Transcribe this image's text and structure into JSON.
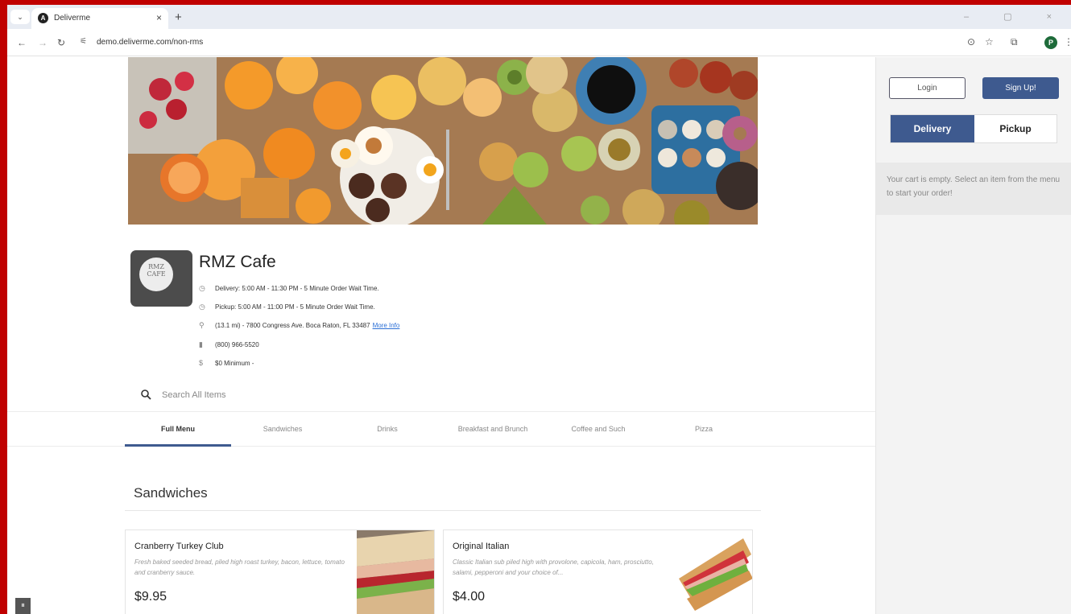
{
  "browser": {
    "tab_title": "Deliverme",
    "tab_close": "×",
    "new_tab": "+",
    "tab_menu": "⌄",
    "favicon_letter": "A",
    "url": "demo.deliverme.com/non-rms",
    "window_controls": "–  ▢  ×",
    "profile_initial": "P",
    "icons": [
      "back-icon",
      "forward-icon",
      "reload-icon",
      "site-settings-icon",
      "location-icon",
      "star-icon",
      "extensions-icon",
      "profile-icon",
      "menu-icon"
    ]
  },
  "auth": {
    "login_label": "Login",
    "signup_label": "Sign Up!"
  },
  "order_mode": {
    "delivery_label": "Delivery",
    "pickup_label": "Pickup",
    "selected": "Delivery"
  },
  "cart": {
    "empty_message": "Your cart is empty. Select an item from the menu to start your order!"
  },
  "restaurant": {
    "name": "RMZ Cafe",
    "logo_text_1": "RMZ",
    "logo_text_2": "CAFE",
    "delivery_hours": "Delivery: 5:00 AM - 11:30 PM - 5 Minute Order Wait Time.",
    "pickup_hours": "Pickup: 5:00 AM - 11:00 PM - 5 Minute Order Wait Time.",
    "address": "(13.1 mi) - 7800 Congress Ave. Boca Raton, FL 33487",
    "more_info_label": "More Info",
    "phone": "(800) 966-5520",
    "minimum": "$0 Minimum -"
  },
  "search": {
    "placeholder": "Search All Items"
  },
  "categories": [
    {
      "label": "Full Menu",
      "active": true
    },
    {
      "label": "Sandwiches",
      "active": false
    },
    {
      "label": "Drinks",
      "active": false
    },
    {
      "label": "Breakfast and Brunch",
      "active": false
    },
    {
      "label": "Coffee and Such",
      "active": false
    },
    {
      "label": "Pizza",
      "active": false
    }
  ],
  "menu": {
    "section_title": "Sandwiches",
    "items": [
      {
        "name": "Cranberry Turkey Club",
        "description": "Fresh baked seeded bread, piled high roast turkey, bacon, lettuce, tomato and cranberry sauce.",
        "price": "$9.95"
      },
      {
        "name": "Original Italian",
        "description": "Classic Italian sub piled high with provolone, capicola, ham, prosciutto, salami, pepperoni and your choice of...",
        "price": "$4.00"
      }
    ]
  },
  "colors": {
    "accent": "#3e5a8f",
    "frame": "#c00000",
    "link": "#2b6fd6"
  }
}
